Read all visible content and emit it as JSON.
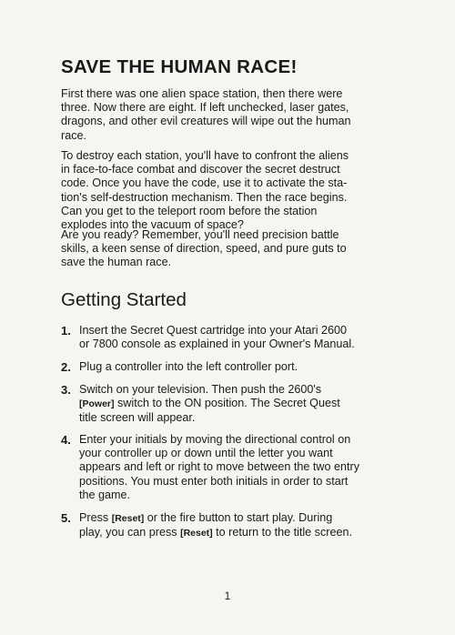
{
  "title": "SAVE THE HUMAN RACE!",
  "intro": [
    [
      "First there was one alien space station, then there were",
      "three. Now there are eight. If left unchecked, laser gates,",
      "dragons, and other evil creatures will wipe out the human",
      "race."
    ],
    [
      "To destroy each station, you'll have to confront the aliens",
      "in face-to-face combat and discover the secret destruct",
      "code. Once you have the code, use it to activate the sta-",
      "tion's self-destruction mechanism. Then the race begins.",
      "Can you get to the teleport room before the station",
      "explodes into the vacuum of space?"
    ],
    [
      "Are you ready? Remember, you'll need precision battle",
      "skills, a keen sense of direction, speed, and pure guts to",
      "save the human race."
    ]
  ],
  "section_title": "Getting Started",
  "steps": [
    {
      "num": "1.",
      "lines": [
        "Insert the Secret Quest cartridge into your Atari 2600",
        "or 7800 console as explained in your Owner's Manual."
      ]
    },
    {
      "num": "2.",
      "lines": [
        "Plug a controller into the left controller port."
      ]
    },
    {
      "num": "3.",
      "line1": "Switch on your television. Then push the 2600's",
      "key_power": "[Power]",
      "line2_rest": " switch to the ON position. The Secret Quest",
      "line3": "title screen will appear."
    },
    {
      "num": "4.",
      "lines": [
        "Enter your initials by moving the directional control on",
        "your controller up or down until the letter you want",
        "appears and left or right to move between the two entry",
        "positions. You must enter both initials in order to start",
        "the game."
      ]
    },
    {
      "num": "5.",
      "line1_pre": "Press ",
      "key_reset_1": "[Reset]",
      "line1_post": " or the fire button to start play. During",
      "line2_pre": "play, you can press ",
      "key_reset_2": "[Reset]",
      "line2_post": " to return to the title screen."
    }
  ],
  "page_number": "1"
}
